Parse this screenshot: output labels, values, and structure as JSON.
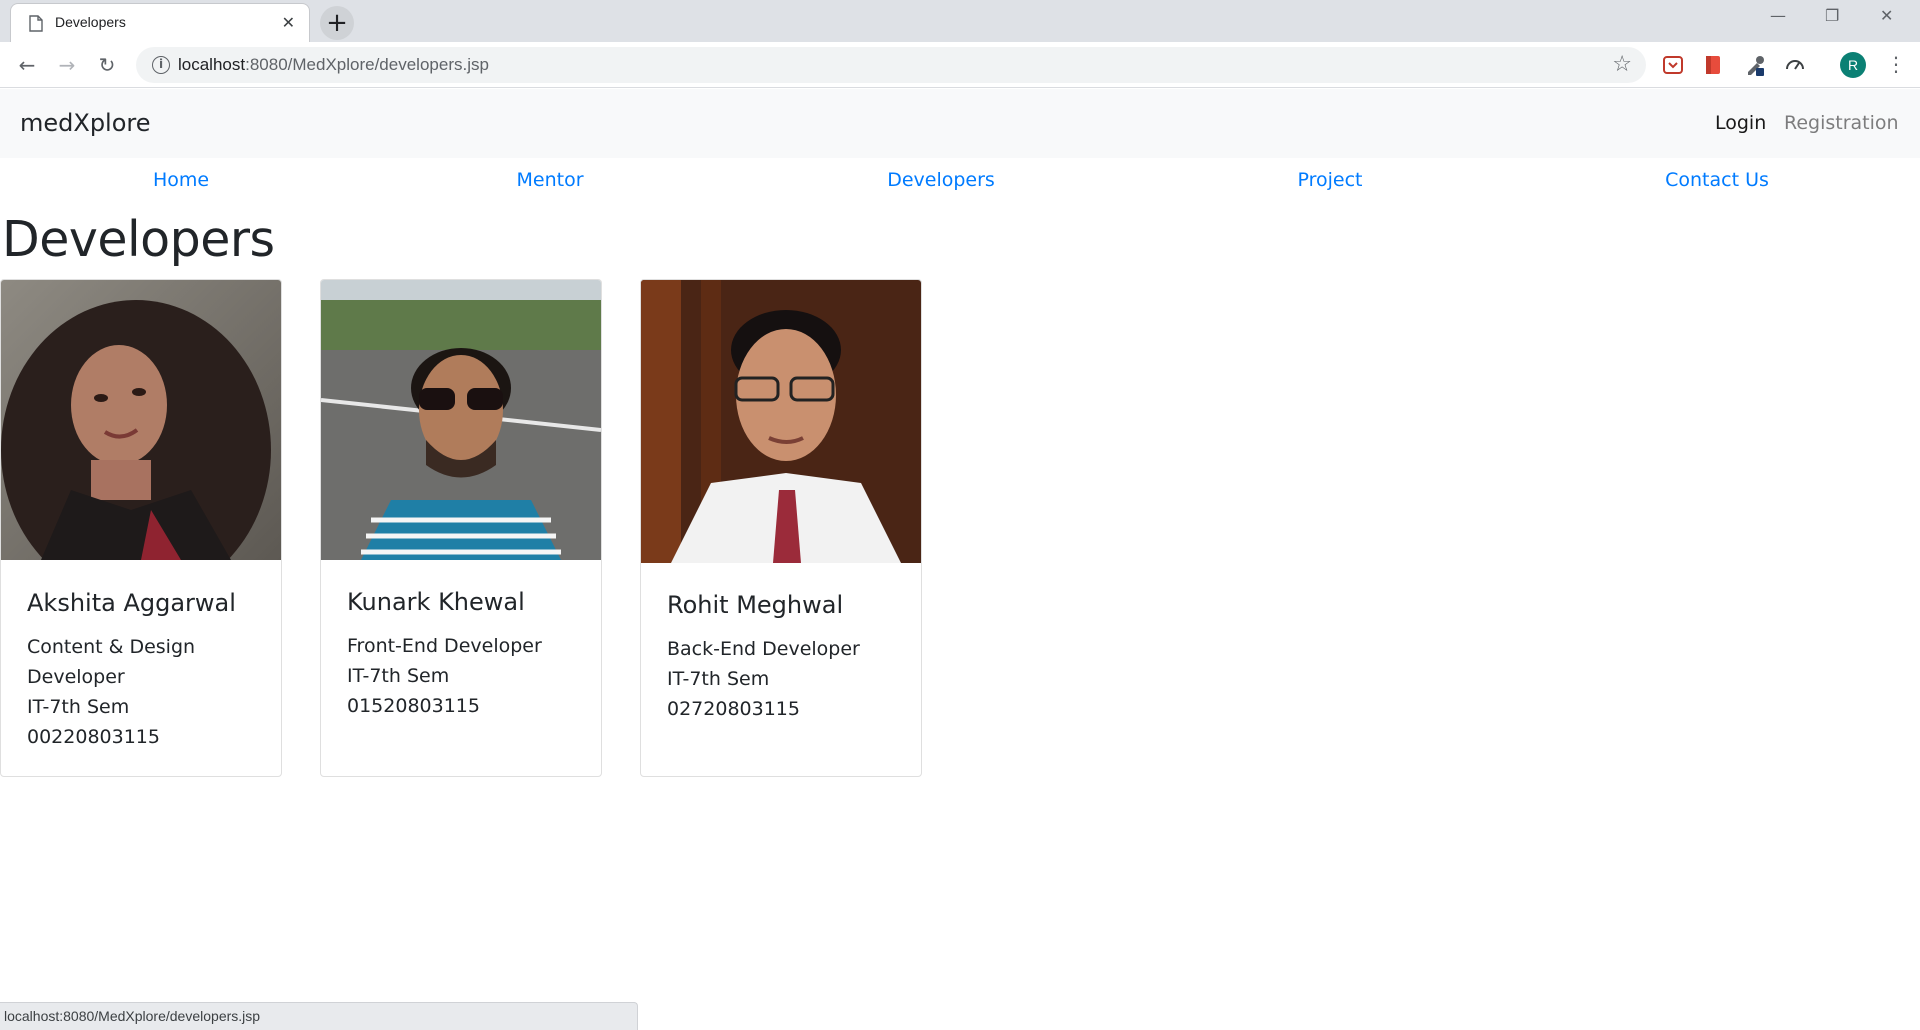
{
  "browser": {
    "tab_title": "Developers",
    "tab_close": "✕",
    "new_tab": "+",
    "url_host": "localhost",
    "url_path": ":8080/MedXplore/developers.jsp",
    "avatar_letter": "R",
    "status_url": "localhost:8080/MedXplore/developers.jsp",
    "window_controls": {
      "minimize": "—",
      "restore": "❐",
      "close": "✕"
    }
  },
  "site": {
    "brand": "medXplore",
    "auth": {
      "login": "Login",
      "registration": "Registration"
    },
    "menu": [
      "Home",
      "Mentor",
      "Developers",
      "Project",
      "Contact Us"
    ],
    "page_title": "Developers"
  },
  "developers": [
    {
      "name": "Akshita Aggarwal",
      "role_line1": "Content & Design",
      "role_line2": "Developer",
      "semester": "IT-7th Sem",
      "roll": "00220803115"
    },
    {
      "name": "Kunark Khewal",
      "role": "Front-End Developer",
      "semester": "IT-7th Sem",
      "roll": "01520803115"
    },
    {
      "name": "Rohit Meghwal",
      "role": "Back-End Developer",
      "semester": "IT-7th Sem",
      "roll": "02720803115"
    }
  ],
  "colors": {
    "link": "#007bff",
    "navbar_bg": "#f8f9fa",
    "avatar_bg": "#0b8074"
  }
}
